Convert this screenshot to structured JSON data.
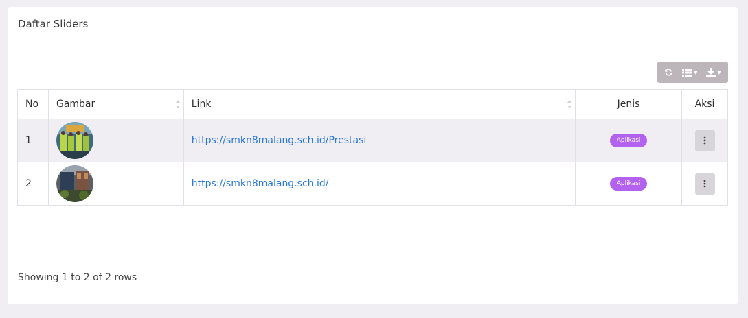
{
  "card": {
    "title": "Daftar Sliders"
  },
  "toolbar": {
    "refresh_icon": "refresh-icon",
    "columns_icon": "list-icon",
    "export_icon": "download-icon"
  },
  "table": {
    "headers": {
      "no": "No",
      "gambar": "Gambar",
      "link": "Link",
      "jenis": "Jenis",
      "aksi": "Aksi"
    },
    "rows": [
      {
        "no": "1",
        "link": "https://smkn8malang.sch.id/Prestasi",
        "jenis": "Aplikasi"
      },
      {
        "no": "2",
        "link": "https://smkn8malang.sch.id/",
        "jenis": "Aplikasi"
      }
    ]
  },
  "footer": {
    "showing": "Showing 1 to 2 of 2 rows"
  },
  "colors": {
    "badge": "#b362f0",
    "link": "#2878d8",
    "background": "#f1eef3"
  }
}
